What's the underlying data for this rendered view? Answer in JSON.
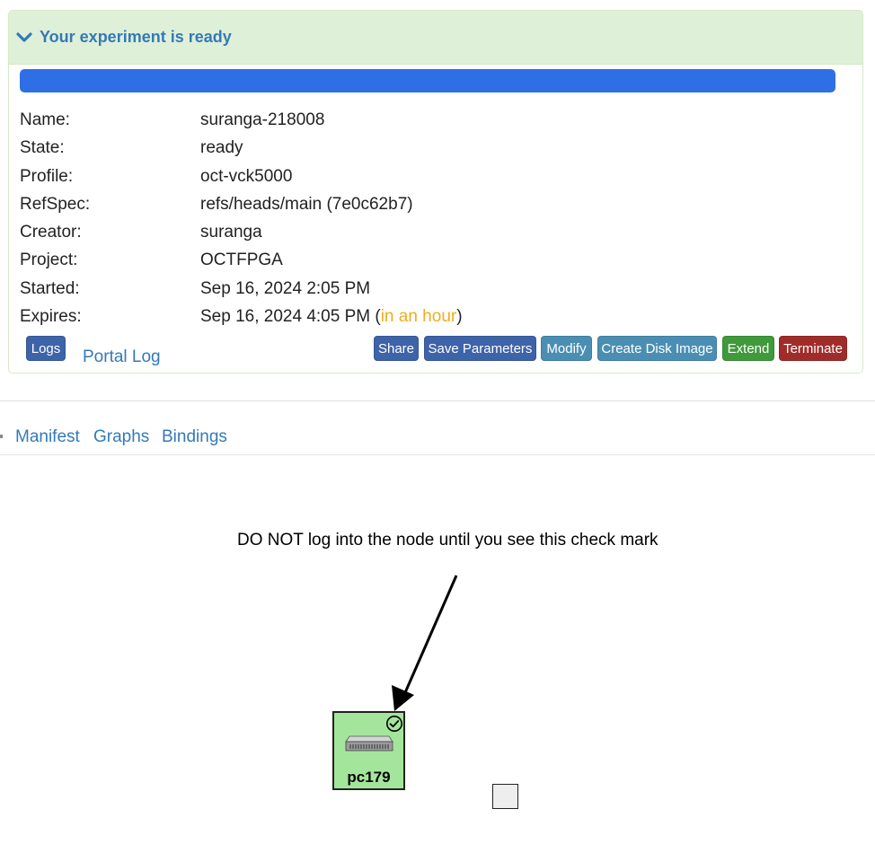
{
  "panel": {
    "title": "Your experiment is ready",
    "progress_percent": 100,
    "fields": {
      "name_label": "Name:",
      "name_value": "suranga-218008",
      "state_label": "State:",
      "state_value": "ready",
      "profile_label": "Profile:",
      "profile_value": "oct-vck5000",
      "refspec_label": "RefSpec:",
      "refspec_value": "refs/heads/main (7e0c62b7)",
      "creator_label": "Creator:",
      "creator_value": "suranga",
      "project_label": "Project:",
      "project_value": "OCTFPGA",
      "started_label": "Started:",
      "started_value": "Sep 16, 2024 2:05 PM",
      "expires_label": "Expires:",
      "expires_value": "Sep 16, 2024 4:05 PM",
      "expires_open": " (",
      "expires_relative": "in an hour",
      "expires_close": ")"
    },
    "buttons": {
      "logs": "Logs",
      "portal_log": "Portal Log",
      "share": "Share",
      "save_parameters": "Save Parameters",
      "modify": "Modify",
      "create_disk_image": "Create Disk Image",
      "extend": "Extend",
      "terminate": "Terminate"
    }
  },
  "tabs": {
    "manifest": "Manifest",
    "graphs": "Graphs",
    "bindings": "Bindings"
  },
  "topology": {
    "notice": "DO NOT log into the node until you see this check mark",
    "node_label": "pc179",
    "node_color": "#a3e69b"
  },
  "colors": {
    "accent": "#337ab7",
    "ready": "#3a8a1e",
    "warning": "#f0ad1e",
    "progress": "#2f6fe6"
  }
}
